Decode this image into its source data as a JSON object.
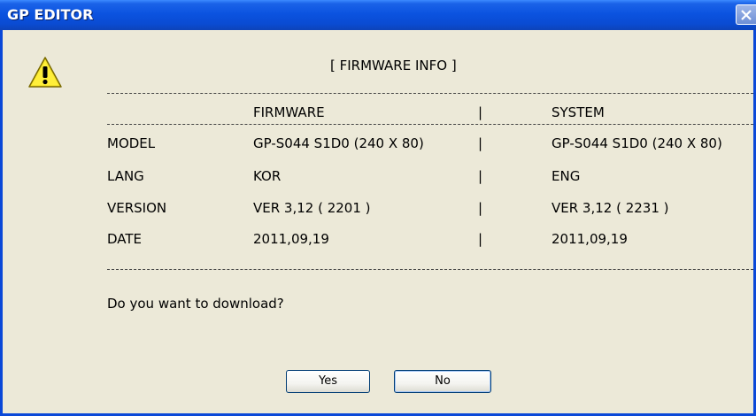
{
  "window": {
    "title": "GP EDITOR"
  },
  "dialog": {
    "heading": "[ FIRMWARE INFO ]",
    "columns": {
      "firmware": "FIRMWARE",
      "sep": "|",
      "system": "SYSTEM"
    },
    "rows": [
      {
        "label": "MODEL",
        "firmware": "GP-S044  S1D0  (240 X 80)",
        "sep": "|",
        "system": "GP-S044  S1D0  (240 X 80)"
      },
      {
        "label": "LANG",
        "firmware": "KOR",
        "sep": "|",
        "system": "ENG"
      },
      {
        "label": "VERSION",
        "firmware": "VER 3,12 ( 2201 )",
        "sep": "|",
        "system": "VER 3,12 ( 2231 )"
      },
      {
        "label": "DATE",
        "firmware": "2011,09,19",
        "sep": "|",
        "system": "2011,09,19"
      }
    ],
    "question": "Do you want to download?",
    "icon": "warning-icon"
  },
  "buttons": {
    "yes": "Yes",
    "no": "No"
  }
}
